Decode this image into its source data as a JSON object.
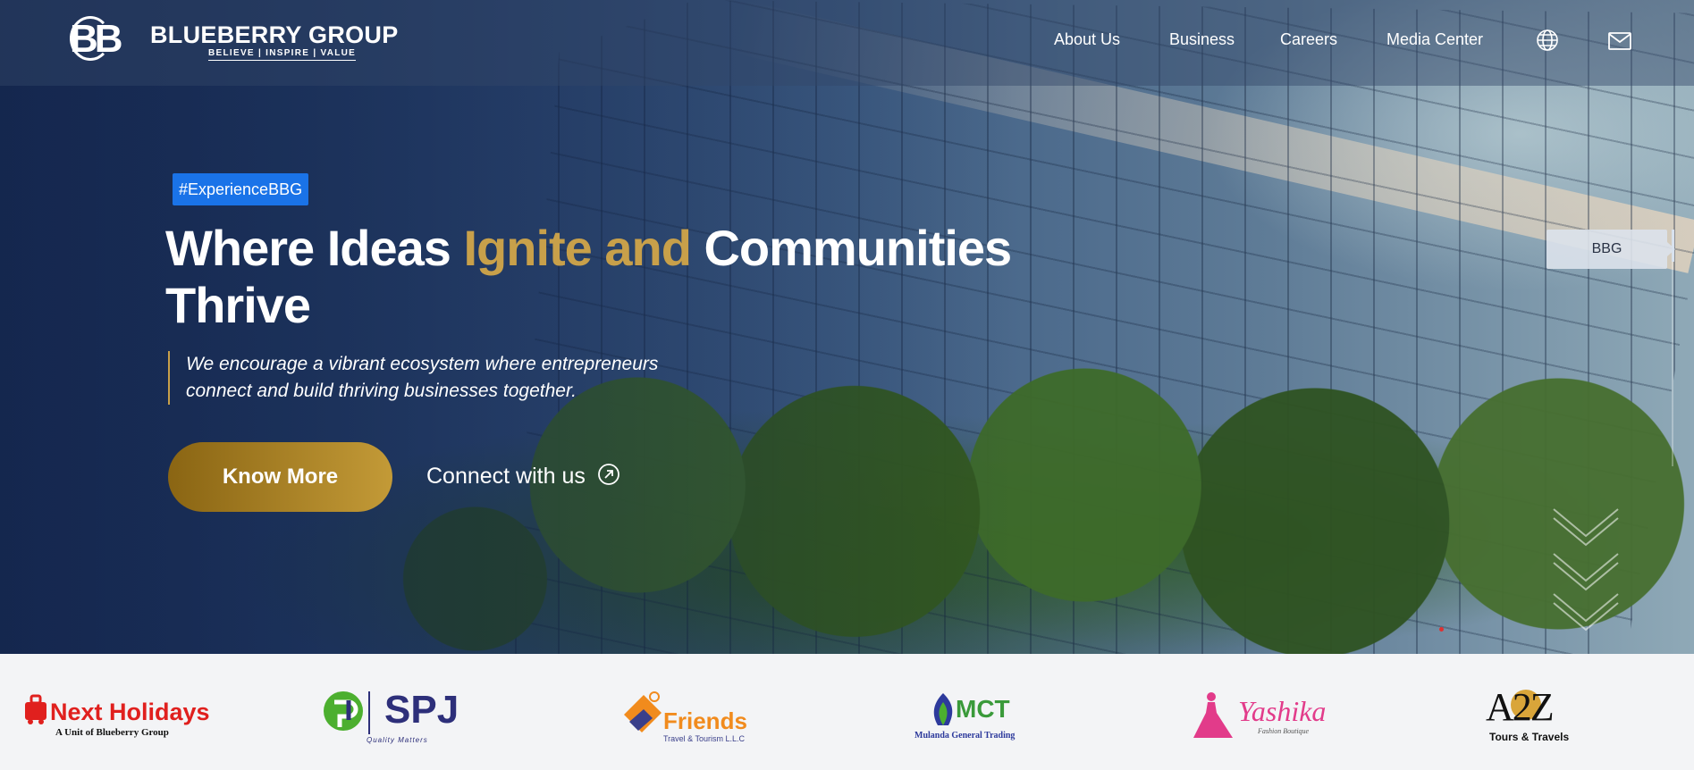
{
  "brand": {
    "mark": "BB",
    "name": "BLUEBERRY GROUP",
    "tagline": "BELIEVE | INSPIRE | VALUE"
  },
  "nav": {
    "items": [
      "About Us",
      "Business",
      "Careers",
      "Media Center"
    ],
    "globe_icon": "globe-icon",
    "mail_icon": "mail-icon"
  },
  "hero": {
    "badge": "#ExperienceBBG",
    "headline_part1": "Where Ideas ",
    "headline_highlight": "Ignite and",
    "headline_part2": " Communities Thrive",
    "subtext": "We encourage a vibrant ecosystem where entrepreneurs connect and build thriving businesses together.",
    "primary_button": "Know More",
    "secondary_button": "Connect with us",
    "side_tab": "BBG"
  },
  "partners": [
    {
      "name": "Next Holidays",
      "sub": "A Unit of Blueberry Group"
    },
    {
      "name": "SPJ",
      "sub": "Quality Matters"
    },
    {
      "name": "Friends",
      "sub": "Travel & Tourism L.L.C"
    },
    {
      "name": "MCT",
      "sub": "Mulanda General Trading"
    },
    {
      "name": "Yashika",
      "sub": "Fashion Boutique"
    },
    {
      "name": "A2Z",
      "sub": "Tours & Travels"
    }
  ],
  "colors": {
    "accent_gold": "#c8a04a",
    "badge_blue": "#1a73e8",
    "next_red": "#e0201e",
    "spj_navy": "#2d2f7a",
    "spj_green": "#4caf2f",
    "friends_orange": "#f18b1d",
    "yashika_pink": "#e23b8a"
  }
}
